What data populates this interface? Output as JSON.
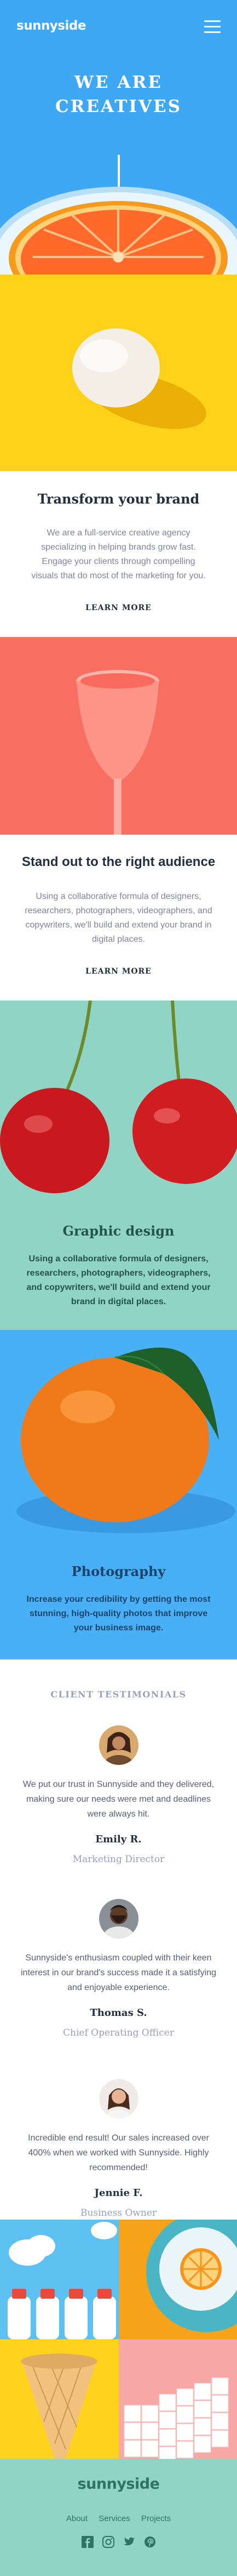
{
  "brand": {
    "logo": "sunnyside"
  },
  "hero": {
    "title_line1": "WE ARE",
    "title_line2": "CREATIVES"
  },
  "brand_section": {
    "title": "Transform your brand",
    "body": "We are a full-service creative agency specializing in helping brands grow fast. Engage your clients through compelling visuals that do most of the marketing for you.",
    "cta": "LEARN MORE"
  },
  "audience_section": {
    "title": "Stand out to the right audience",
    "body": "Using a collaborative formula of designers, researchers, photographers, videographers, and copywriters, we'll build and extend your brand in digital places.",
    "cta": "LEARN MORE"
  },
  "graphic_design": {
    "title": "Graphic design",
    "body": "Using a collaborative formula of designers, researchers, photographers, videographers, and copywriters, we'll build and extend your brand in digital places."
  },
  "photography": {
    "title": "Photography",
    "body": "Increase your credibility by getting the most stunning, high-quality photos that improve your business image."
  },
  "testimonials": {
    "heading": "CLIENT TESTIMONIALS",
    "items": [
      {
        "quote": "We put our trust in Sunnyside and they delivered, making sure our needs were met and deadlines were always hit.",
        "name": "Emily R.",
        "role": "Marketing Director"
      },
      {
        "quote": "Sunnyside's enthusiasm coupled with their keen interest in our brand's success made it a satisfying and enjoyable experience.",
        "name": "Thomas S.",
        "role": "Chief Operating Officer"
      },
      {
        "quote": "Incredible end result! Our sales increased over 400% when we worked with Sunnyside. Highly recommended!",
        "name": "Jennie F.",
        "role": "Business Owner"
      }
    ]
  },
  "footer": {
    "logo": "sunnyside",
    "links": [
      "About",
      "Services",
      "Projects"
    ],
    "social_icons": [
      "facebook-icon",
      "instagram-icon",
      "twitter-icon",
      "pinterest-icon"
    ]
  },
  "colors": {
    "hero_bg": "#3ea8f4",
    "yellow": "#fed11b",
    "salmon": "#f96e62",
    "mint": "#90d4c5",
    "sky": "#4ab0f5",
    "dark_text": "#23303e"
  }
}
